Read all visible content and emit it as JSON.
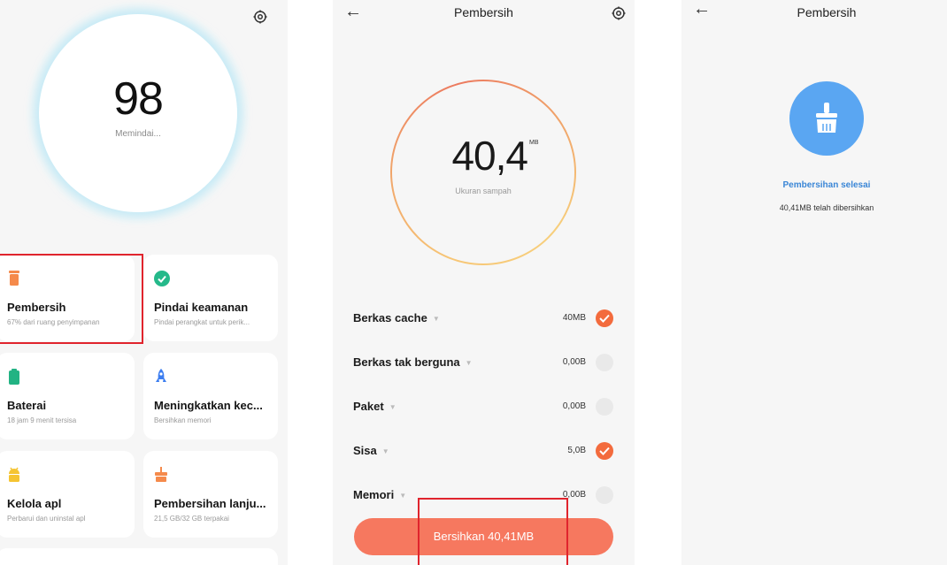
{
  "screen1": {
    "score": "98",
    "status": "Memindai...",
    "cards": [
      {
        "title": "Pembersih",
        "subtitle": "67% dari ruang penyimpanan",
        "icon": "trash-icon",
        "color": "#f58a4b"
      },
      {
        "title": "Pindai keamanan",
        "subtitle": "Pindai perangkat untuk perik...",
        "icon": "check-shield-icon",
        "color": "#25b98a"
      },
      {
        "title": "Baterai",
        "subtitle": "18 jam 9 menit tersisa",
        "icon": "battery-icon",
        "color": "#22b383"
      },
      {
        "title": "Meningkatkan kec...",
        "subtitle": "Bersihkan memori",
        "icon": "rocket-icon",
        "color": "#3d7ef0"
      },
      {
        "title": "Kelola apl",
        "subtitle": "Perbarui dan uninstal apl",
        "icon": "android-icon",
        "color": "#f5c431"
      },
      {
        "title": "Pembersihan lanju...",
        "subtitle": "21,5 GB/32 GB terpakai",
        "icon": "deep-clean-icon",
        "color": "#f58a4b"
      }
    ]
  },
  "screen2": {
    "title": "Pembersih",
    "amount": "40,4",
    "unit": "MB",
    "amount_label": "Ukuran sampah",
    "rows": [
      {
        "label": "Berkas cache",
        "size": "40MB",
        "checked": true
      },
      {
        "label": "Berkas tak berguna",
        "size": "0,00B",
        "checked": false
      },
      {
        "label": "Paket",
        "size": "0,00B",
        "checked": false
      },
      {
        "label": "Sisa",
        "size": "5,0B",
        "checked": true
      },
      {
        "label": "Memori",
        "size": "0,00B",
        "checked": false
      }
    ],
    "cta": "Bersihkan 40,41MB",
    "accent": "#f36b3d"
  },
  "screen3": {
    "title": "Pembersih",
    "done_title": "Pembersihan selesai",
    "done_sub": "40,41MB telah dibersihkan",
    "accent": "#5aa6f2"
  }
}
